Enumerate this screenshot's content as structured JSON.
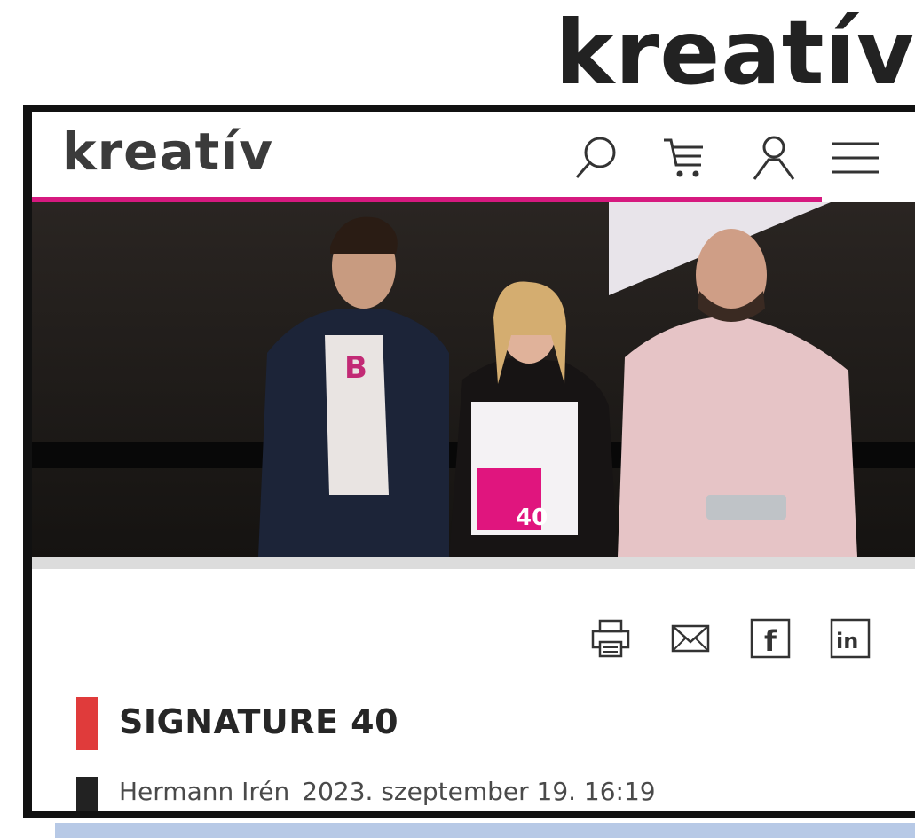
{
  "brand": {
    "big_logo": "kreatív",
    "site_logo": "kreatív"
  },
  "header": {
    "icons": [
      "search-icon",
      "cart-icon",
      "user-icon",
      "menu-icon"
    ],
    "accent_color": "#d6197f"
  },
  "hero": {
    "description_icon": "award-photo"
  },
  "share": {
    "icons": [
      "print-icon",
      "email-icon",
      "facebook-icon",
      "linkedin-icon"
    ],
    "facebook_letter": "f",
    "linkedin_text": "in"
  },
  "article": {
    "title": "SIGNATURE 40",
    "author": "Hermann Irén",
    "date": "2023. szeptember 19. 16:19",
    "title_bar_color": "#e03b3b"
  },
  "trophy": {
    "text": "40"
  }
}
